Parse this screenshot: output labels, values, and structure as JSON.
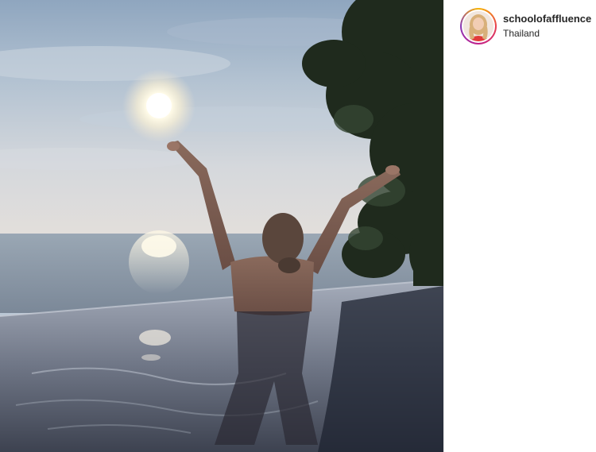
{
  "post": {
    "username": "schoolofaffluence",
    "location": "Thailand"
  },
  "icons": {
    "avatar": "profile-photo",
    "story_ring": "story-ring-icon"
  },
  "colors": {
    "text": "#262626",
    "background": "#ffffff",
    "ring_gradient": [
      "#f7b500",
      "#e8404f",
      "#c21f8a",
      "#8a3ab9"
    ]
  }
}
